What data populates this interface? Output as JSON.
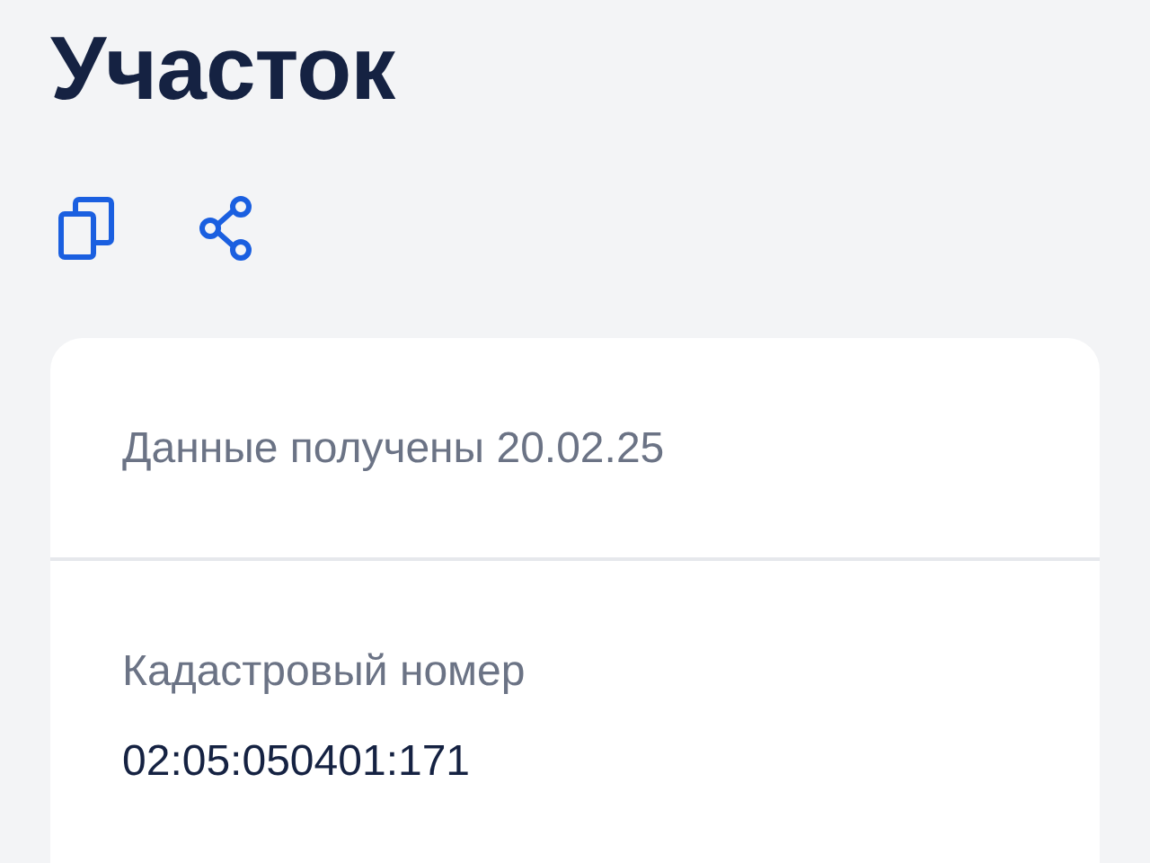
{
  "title": "Участок",
  "actions": [
    {
      "kind": "copy"
    },
    {
      "kind": "share"
    }
  ],
  "card": {
    "updated": "Данные получены 20.02.25",
    "fields": [
      {
        "label": "Кадастровый номер",
        "value": "02:05:050401:171"
      }
    ]
  }
}
